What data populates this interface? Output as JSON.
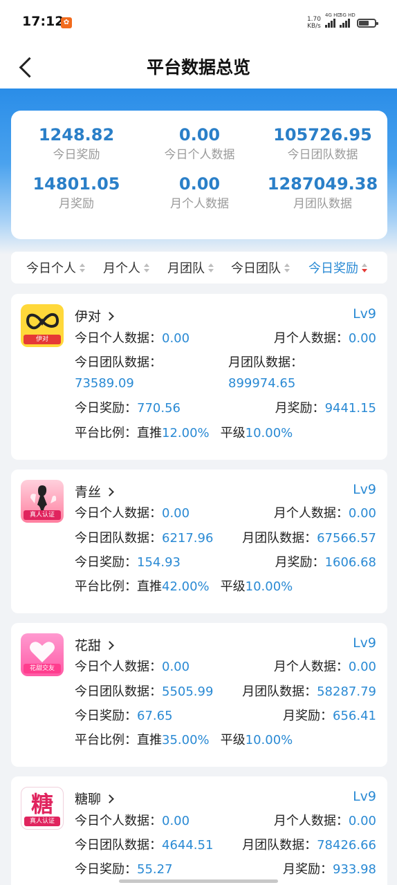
{
  "status_bar": {
    "time": "17:12",
    "net_speed": "1.70",
    "net_unit": "KB/s",
    "sim1": "4G HD",
    "sim2": "5G HD"
  },
  "nav": {
    "title": "平台数据总览"
  },
  "summary": [
    {
      "value": "1248.82",
      "label": "今日奖励"
    },
    {
      "value": "0.00",
      "label": "今日个人数据"
    },
    {
      "value": "105726.95",
      "label": "今日团队数据"
    },
    {
      "value": "14801.05",
      "label": "月奖励"
    },
    {
      "value": "0.00",
      "label": "月个人数据"
    },
    {
      "value": "1287049.38",
      "label": "月团队数据"
    }
  ],
  "sort_tabs": [
    {
      "label": "今日个人",
      "active": false
    },
    {
      "label": "月个人",
      "active": false
    },
    {
      "label": "月团队",
      "active": false
    },
    {
      "label": "今日团队",
      "active": false
    },
    {
      "label": "今日奖励",
      "active": true
    }
  ],
  "platforms": [
    {
      "name": "伊对",
      "level": "Lv9",
      "logo_tag": "伊对",
      "today_personal_label": "今日个人数据：",
      "today_personal": "0.00",
      "month_personal_label": "月个人数据：",
      "month_personal": "0.00",
      "today_team_label": "今日团队数据：",
      "today_team": "73589.09",
      "month_team_label": "月团队数据：",
      "month_team": "899974.65",
      "today_reward_label": "今日奖励：",
      "today_reward": "770.56",
      "month_reward_label": "月奖励：",
      "month_reward": "9441.15",
      "ratio_label": "平台比例：",
      "direct_label": "直推",
      "direct": "12.00%",
      "peer_label": "平级",
      "peer": "10.00%"
    },
    {
      "name": "青丝",
      "level": "Lv9",
      "logo_tag": "真人认证",
      "today_personal_label": "今日个人数据：",
      "today_personal": "0.00",
      "month_personal_label": "月个人数据：",
      "month_personal": "0.00",
      "today_team_label": "今日团队数据：",
      "today_team": "6217.96",
      "month_team_label": "月团队数据：",
      "month_team": "67566.57",
      "today_reward_label": "今日奖励：",
      "today_reward": "154.93",
      "month_reward_label": "月奖励：",
      "month_reward": "1606.68",
      "ratio_label": "平台比例：",
      "direct_label": "直推",
      "direct": "42.00%",
      "peer_label": "平级",
      "peer": "10.00%"
    },
    {
      "name": "花甜",
      "level": "Lv9",
      "logo_tag": "花甜交友",
      "today_personal_label": "今日个人数据：",
      "today_personal": "0.00",
      "month_personal_label": "月个人数据：",
      "month_personal": "0.00",
      "today_team_label": "今日团队数据：",
      "today_team": "5505.99",
      "month_team_label": "月团队数据：",
      "month_team": "58287.79",
      "today_reward_label": "今日奖励：",
      "today_reward": "67.65",
      "month_reward_label": "月奖励：",
      "month_reward": "656.41",
      "ratio_label": "平台比例：",
      "direct_label": "直推",
      "direct": "35.00%",
      "peer_label": "平级",
      "peer": "10.00%"
    },
    {
      "name": "糖聊",
      "level": "Lv9",
      "logo_tag": "真人认证",
      "logo_char": "糖",
      "today_personal_label": "今日个人数据：",
      "today_personal": "0.00",
      "month_personal_label": "月个人数据：",
      "month_personal": "0.00",
      "today_team_label": "今日团队数据：",
      "today_team": "4644.51",
      "month_team_label": "月团队数据：",
      "month_team": "78426.66",
      "today_reward_label": "今日奖励：",
      "today_reward": "55.27",
      "month_reward_label": "月奖励：",
      "month_reward": "933.98"
    }
  ]
}
